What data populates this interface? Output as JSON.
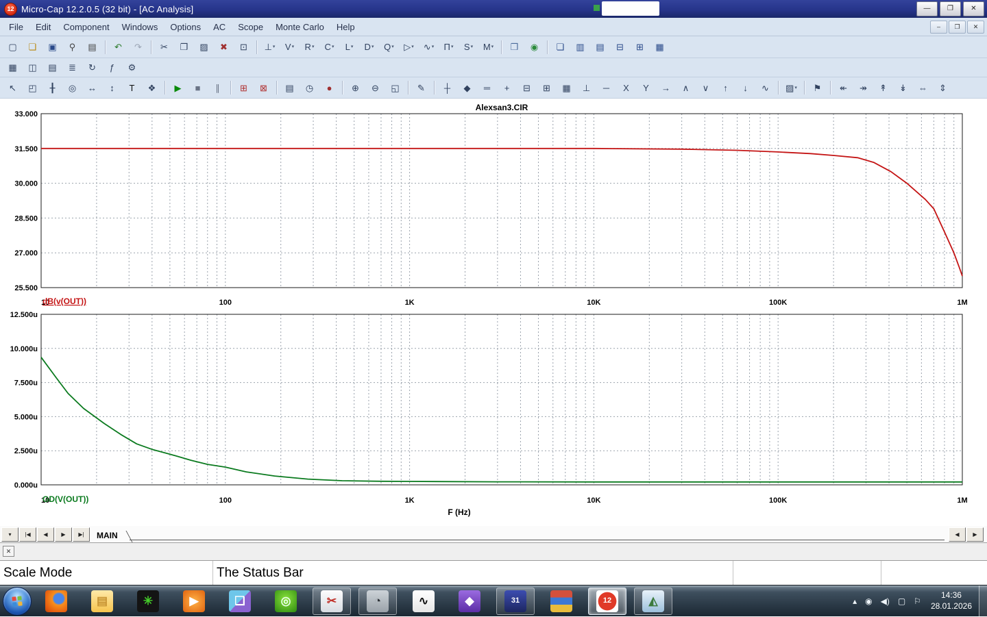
{
  "window": {
    "title": "Micro-Cap 12.2.0.5 (32 bit) - [AC Analysis]",
    "icon_text": "12",
    "controls": {
      "minimize": "—",
      "restore": "❐",
      "close": "✕"
    }
  },
  "menu": {
    "items": [
      "File",
      "Edit",
      "Component",
      "Windows",
      "Options",
      "AC",
      "Scope",
      "Monte Carlo",
      "Help"
    ],
    "mdi_controls": [
      "–",
      "❐",
      "✕"
    ]
  },
  "toolbars": {
    "row1": [
      {
        "name": "new-file",
        "glyph": "▢"
      },
      {
        "name": "open-file",
        "glyph": "❏",
        "fg": "#b8860b"
      },
      {
        "name": "save-file",
        "glyph": "▣",
        "fg": "#2a4a8a"
      },
      {
        "name": "print-preview",
        "glyph": "⚲",
        "fg": "#444"
      },
      {
        "name": "print",
        "glyph": "▤",
        "fg": "#444"
      },
      {
        "separator": true
      },
      {
        "name": "undo",
        "glyph": "↶",
        "fg": "#2a7a2a"
      },
      {
        "name": "redo",
        "glyph": "↷",
        "fg": "#9aa4b4"
      },
      {
        "separator": true
      },
      {
        "name": "cut",
        "glyph": "✂"
      },
      {
        "name": "copy",
        "glyph": "❐"
      },
      {
        "name": "paste",
        "glyph": "▨"
      },
      {
        "name": "clear",
        "glyph": "✖",
        "fg": "#a03030"
      },
      {
        "name": "select-all",
        "glyph": "⊡"
      },
      {
        "separator": true
      },
      {
        "name": "ground-component",
        "glyph": "⊥",
        "dropdown": true
      },
      {
        "name": "battery-component",
        "glyph": "V",
        "dropdown": true
      },
      {
        "name": "resistor-component",
        "glyph": "R",
        "dropdown": true
      },
      {
        "name": "capacitor-component",
        "glyph": "C",
        "dropdown": true
      },
      {
        "name": "inductor-component",
        "glyph": "L",
        "dropdown": true
      },
      {
        "name": "diode-component",
        "glyph": "D",
        "dropdown": true
      },
      {
        "name": "transistor-component",
        "glyph": "Q",
        "dropdown": true
      },
      {
        "name": "opamp-component",
        "glyph": "▷",
        "dropdown": true
      },
      {
        "name": "sine-source-component",
        "glyph": "∿",
        "dropdown": true
      },
      {
        "name": "pulse-source-component",
        "glyph": "Π",
        "dropdown": true
      },
      {
        "name": "switch-component",
        "glyph": "S",
        "dropdown": true
      },
      {
        "name": "macro-component",
        "glyph": "M",
        "dropdown": true
      },
      {
        "separator": true
      },
      {
        "name": "info-window",
        "glyph": "❒",
        "fg": "#4a6a9a"
      },
      {
        "name": "internet-link",
        "glyph": "◉",
        "fg": "#2a8a3a"
      },
      {
        "separator": true
      },
      {
        "name": "cascade-windows",
        "glyph": "❏",
        "fg": "#2a4a8a"
      },
      {
        "name": "tile-vertical",
        "glyph": "▥",
        "fg": "#2a4a8a"
      },
      {
        "name": "tile-horizontal",
        "glyph": "▤",
        "fg": "#2a4a8a"
      },
      {
        "name": "split-horizontal",
        "glyph": "⊟",
        "fg": "#2a4a8a"
      },
      {
        "name": "split-vertical",
        "glyph": "⊞",
        "fg": "#2a4a8a"
      },
      {
        "name": "numeric-grid",
        "glyph": "▦",
        "fg": "#2a4a8a"
      }
    ],
    "row2": [
      {
        "name": "component-panel",
        "glyph": "▦"
      },
      {
        "name": "browser-panel",
        "glyph": "◫"
      },
      {
        "name": "file-tabs",
        "glyph": "▤"
      },
      {
        "name": "outline-view",
        "glyph": "≣"
      },
      {
        "name": "redraw",
        "glyph": "↻"
      },
      {
        "name": "function-plot",
        "glyph": "ƒ"
      },
      {
        "name": "preferences",
        "glyph": "⚙"
      }
    ],
    "row3": [
      {
        "name": "select-mode",
        "glyph": "↖"
      },
      {
        "name": "scale-mode",
        "glyph": "◰"
      },
      {
        "name": "cursor-mode",
        "glyph": "╂"
      },
      {
        "name": "point-tag-mode",
        "glyph": "◎"
      },
      {
        "name": "horizontal-tag-mode",
        "glyph": "↔"
      },
      {
        "name": "vertical-tag-mode",
        "glyph": "↕"
      },
      {
        "name": "text-mode",
        "glyph": "T",
        "fg": "#111"
      },
      {
        "name": "properties",
        "glyph": "❖"
      },
      {
        "separator": true
      },
      {
        "name": "run",
        "glyph": "▶",
        "fg": "#0a8a0a"
      },
      {
        "name": "stop",
        "glyph": "■",
        "fg": "#6a7486"
      },
      {
        "name": "pause",
        "glyph": "∥",
        "fg": "#6a7486"
      },
      {
        "separator": true
      },
      {
        "name": "add-analysis-limits",
        "glyph": "⊞",
        "fg": "#b03030"
      },
      {
        "name": "delete-analysis-limits",
        "glyph": "⊠",
        "fg": "#b03030"
      },
      {
        "separator": true
      },
      {
        "name": "numeric-output",
        "glyph": "▤"
      },
      {
        "name": "watch-window",
        "glyph": "◷"
      },
      {
        "name": "breakpoints",
        "glyph": "●",
        "fg": "#a03030"
      },
      {
        "separator": true
      },
      {
        "name": "zoom-in",
        "glyph": "⊕"
      },
      {
        "name": "zoom-out",
        "glyph": "⊖"
      },
      {
        "name": "autoscale",
        "glyph": "◱"
      },
      {
        "separator": true
      },
      {
        "name": "edit-text",
        "glyph": "✎"
      },
      {
        "separator": true
      },
      {
        "name": "data-points",
        "glyph": "┼"
      },
      {
        "name": "tokens",
        "glyph": "◆"
      },
      {
        "name": "ruler-lines",
        "glyph": "═"
      },
      {
        "name": "plus-marks",
        "glyph": "+"
      },
      {
        "name": "horizontal-axis-grids",
        "glyph": "⊟"
      },
      {
        "name": "vertical-axis-grids",
        "glyph": "⊞"
      },
      {
        "name": "minor-log-grids",
        "glyph": "▦"
      },
      {
        "name": "baseline",
        "glyph": "⊥"
      },
      {
        "name": "horizontal-cursor",
        "glyph": "─"
      },
      {
        "name": "go-to-x",
        "glyph": "X"
      },
      {
        "name": "go-to-y",
        "glyph": "Y"
      },
      {
        "name": "next-data-point",
        "glyph": "→"
      },
      {
        "name": "peak",
        "glyph": "∧"
      },
      {
        "name": "valley",
        "glyph": "∨"
      },
      {
        "name": "high",
        "glyph": "↑"
      },
      {
        "name": "low",
        "glyph": "↓"
      },
      {
        "name": "inflection",
        "glyph": "∿"
      },
      {
        "separator": true
      },
      {
        "name": "copy-to-clipboard",
        "glyph": "▨",
        "dropdown": true
      },
      {
        "separator": true
      },
      {
        "name": "navigate-flag",
        "glyph": "⚑"
      },
      {
        "separator": true
      },
      {
        "name": "align-left",
        "glyph": "↞"
      },
      {
        "name": "align-right",
        "glyph": "↠"
      },
      {
        "name": "align-top",
        "glyph": "↟"
      },
      {
        "name": "align-bottom",
        "glyph": "↡"
      },
      {
        "name": "align-center-horizontal",
        "glyph": "⇔"
      },
      {
        "name": "align-center-vertical",
        "glyph": "⇕"
      }
    ]
  },
  "chart_data": [
    {
      "type": "line",
      "title": "Alexsan3.CIR",
      "xscale": "log",
      "xlim": [
        10,
        1000000
      ],
      "ylim": [
        25.5,
        33.0
      ],
      "xlabel": "F (Hz)",
      "x_tick_labels": [
        "10",
        "100",
        "1K",
        "10K",
        "100K",
        "1M"
      ],
      "x_tick_values": [
        10,
        100,
        1000,
        10000,
        100000,
        1000000
      ],
      "y_tick_labels": [
        "33.000",
        "31.500",
        "30.000",
        "28.500",
        "27.000",
        "25.500"
      ],
      "y_tick_values": [
        33.0,
        31.5,
        30.0,
        28.5,
        27.0,
        25.5
      ],
      "grid": "dashed",
      "legend_position": "below-left",
      "series": [
        {
          "name": "dB(v(OUT))",
          "color": "#c41414",
          "x": [
            10,
            100,
            1000,
            10000,
            30000,
            60000,
            100000,
            150000,
            200000,
            270000,
            330000,
            410000,
            500000,
            630000,
            700000,
            800000,
            900000,
            960000,
            1000000
          ],
          "y": [
            31.5,
            31.5,
            31.5,
            31.5,
            31.47,
            31.42,
            31.35,
            31.28,
            31.2,
            31.1,
            30.9,
            30.5,
            30.0,
            29.3,
            28.9,
            27.9,
            27.0,
            26.4,
            26.0
          ]
        }
      ]
    },
    {
      "type": "line",
      "title": "",
      "xscale": "log",
      "xlim": [
        10,
        1000000
      ],
      "ylim": [
        0,
        12.5
      ],
      "y_unit": "µs",
      "xlabel": "F (Hz)",
      "x_tick_labels": [
        "10",
        "100",
        "1K",
        "10K",
        "100K",
        "1M"
      ],
      "x_tick_values": [
        10,
        100,
        1000,
        10000,
        100000,
        1000000
      ],
      "y_tick_labels": [
        "12.500u",
        "10.000u",
        "7.500u",
        "5.000u",
        "2.500u",
        "0.000u"
      ],
      "y_tick_values": [
        12.5,
        10.0,
        7.5,
        5.0,
        2.5,
        0.0
      ],
      "grid": "dashed",
      "legend_position": "below-left",
      "series": [
        {
          "name": "GD(V(OUT))",
          "color": "#0a7a1e",
          "x": [
            10,
            12,
            14,
            17,
            22,
            27,
            33,
            40,
            50,
            65,
            80,
            100,
            130,
            185,
            280,
            430,
            700,
            1000,
            3000,
            10000,
            100000,
            1000000
          ],
          "y": [
            9.35,
            7.9,
            6.7,
            5.6,
            4.5,
            3.7,
            3.0,
            2.6,
            2.25,
            1.8,
            1.5,
            1.3,
            0.95,
            0.65,
            0.42,
            0.3,
            0.26,
            0.25,
            0.22,
            0.21,
            0.21,
            0.21
          ]
        }
      ]
    }
  ],
  "tabbar": {
    "nav": [
      {
        "name": "page-list",
        "glyph": "▾"
      },
      {
        "name": "first-page",
        "glyph": "|◀"
      },
      {
        "name": "previous-page",
        "glyph": "◀"
      },
      {
        "name": "next-page",
        "glyph": "▶"
      },
      {
        "name": "last-page",
        "glyph": "▶|"
      }
    ],
    "tab": "MAIN",
    "scroll": [
      {
        "name": "tab-scroll-left",
        "glyph": "◀"
      },
      {
        "name": "tab-scroll-right",
        "glyph": "▶"
      }
    ]
  },
  "dockstrip": {
    "close_label": "✕"
  },
  "statusbar": {
    "left": "Scale Mode",
    "middle": "The Status Bar"
  },
  "taskbar": {
    "items": [
      {
        "name": "firefox",
        "bg": "radial-gradient(circle at 62% 38%, #4a86e8 0%, #4a86e8 26%, #f78f1e 34%, #e3590e 78%, #b5470b 100%)",
        "glyph": "",
        "fg": "#fff",
        "open": false
      },
      {
        "name": "windows-explorer",
        "bg": "linear-gradient(180deg,#ffe9a8,#f6c44e)",
        "glyph": "▤",
        "fg": "#c79332",
        "open": false
      },
      {
        "name": "spider-player",
        "bg": "#141414",
        "glyph": "✳",
        "fg": "#46d02a",
        "open": false
      },
      {
        "name": "media-player",
        "bg": "radial-gradient(circle,#ffb347,#e06410)",
        "glyph": "▶",
        "fg": "#fff",
        "open": false
      },
      {
        "name": "notes-app",
        "bg": "linear-gradient(135deg,#6ec6ea 50%,#8a62d0 50%)",
        "glyph": "❏",
        "fg": "#fff",
        "open": false
      },
      {
        "name": "green-orb-app",
        "bg": "radial-gradient(circle at 50% 40%,#8ae23c,#2e8a10)",
        "glyph": "◎",
        "fg": "#eaffea",
        "open": false
      },
      {
        "name": "snipping-tool",
        "bg": "linear-gradient(#fdfdfd,#d8dde2)",
        "glyph": "✂",
        "fg": "#c03028",
        "open": true
      },
      {
        "name": "gauge-app",
        "bg": "linear-gradient(#cdd3d8,#9aa2a9)",
        "glyph": "◔",
        "fg": "#30353a",
        "open": true
      },
      {
        "name": "waveform-app",
        "bg": "linear-gradient(#ffffff,#e6e6e6)",
        "glyph": "∿",
        "fg": "#111",
        "open": false
      },
      {
        "name": "purple-app",
        "bg": "linear-gradient(#9a6ae0,#5c2ea6)",
        "glyph": "◆",
        "fg": "#fff",
        "open": false
      },
      {
        "name": "calendar-app",
        "bg": "linear-gradient(#3c4db0,#1d2660)",
        "glyph": "31",
        "fg": "#fff",
        "open": true
      },
      {
        "name": "winrar",
        "bg": "linear-gradient(180deg,#d4503c 33%,#3c78d4 33%,#3c78d4 66%,#e8bc3c 66%)",
        "glyph": "",
        "fg": "#fff",
        "open": false
      },
      {
        "name": "micro-cap-12",
        "bg": "radial-gradient(circle,#e03a28 58%,#ffffff 60%)",
        "glyph": "12",
        "fg": "#fff",
        "open": true,
        "active": true
      },
      {
        "name": "photo-viewer",
        "bg": "linear-gradient(#e8f2fa,#9cc0dc)",
        "glyph": "◭",
        "fg": "#3c7a3c",
        "open": true
      }
    ],
    "tray": [
      {
        "name": "show-hidden-icons",
        "glyph": "▴"
      },
      {
        "name": "tray-app",
        "glyph": "◉"
      },
      {
        "name": "volume",
        "glyph": "◀)"
      },
      {
        "name": "network",
        "glyph": "▢"
      },
      {
        "name": "action-center-flag",
        "glyph": "⚐"
      }
    ],
    "clock": {
      "time": "14:36",
      "date": "28.01.2026"
    }
  }
}
